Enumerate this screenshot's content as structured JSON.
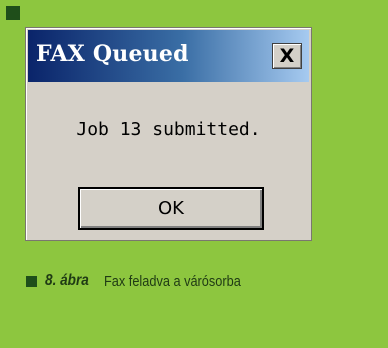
{
  "dialog": {
    "title": "FAX Queued",
    "close_label": "X",
    "message": "Job 13 submitted.",
    "ok_label": "OK"
  },
  "caption": {
    "number": "8. ábra",
    "text": "Fax feladva a várósorba"
  },
  "icons": {
    "close": "close-icon"
  },
  "colors": {
    "background": "#8dc63f",
    "titlebar_dark": "#0a246a",
    "titlebar_light": "#a6caf0",
    "dialog_face": "#d5d0c8",
    "accent_dark": "#1f4e1a"
  }
}
